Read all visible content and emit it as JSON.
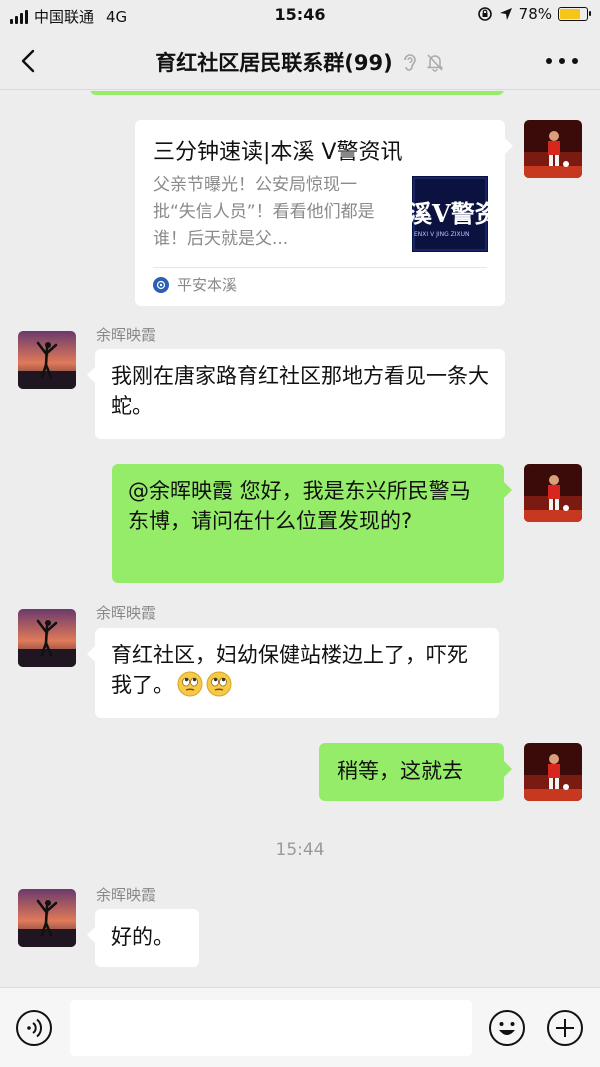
{
  "status_bar": {
    "carrier": "中国联通",
    "network": "4G",
    "time": "15:46",
    "battery_percent": "78%",
    "battery_level": 0.78
  },
  "nav": {
    "title": "育红社区居民联系群(99)"
  },
  "link_card": {
    "title": "三分钟速读|本溪 V警资讯",
    "description": "父亲节曝光！公安局惊现一批“失信人员”！看看他们都是谁！后天就是父...",
    "thumbnail_text": "溪V警资",
    "thumbnail_subtext": "ENXI V JING ZIXUN",
    "source": "平安本溪"
  },
  "messages": [
    {
      "sender": "余晖映霞",
      "text": "我刚在唐家路育红社区那地方看见一条大蛇。"
    },
    {
      "text": "@余晖映霞 您好，我是东兴所民警马东博，请问在什么位置发现的?"
    },
    {
      "sender": "余晖映霞",
      "text": "育红社区，妇幼保健站楼边上了，吓死我了。"
    },
    {
      "text": "稍等，这就去"
    },
    {
      "sender": "余晖映霞",
      "text": "好的。"
    }
  ],
  "time_separator": "15:44",
  "colors": {
    "background": "#ededed",
    "outgoing_bubble": "#95ec69",
    "incoming_bubble": "#ffffff",
    "battery": "#f5c518"
  },
  "icons": [
    "back-arrow-icon",
    "ear-icon",
    "mute-bell-icon",
    "more-icon",
    "voice-icon",
    "emoji-icon",
    "plus-icon",
    "rolling-eyes-emoji"
  ]
}
